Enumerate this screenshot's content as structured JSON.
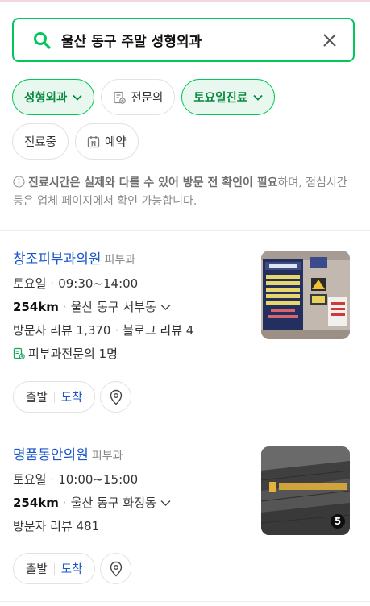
{
  "search": {
    "query": "울산 동구 주말 성형외과"
  },
  "filters": [
    {
      "label": "성형외과",
      "active": true,
      "dropdown": true,
      "icon": ""
    },
    {
      "label": "전문의",
      "active": false,
      "dropdown": false,
      "icon": "certified-doctor-icon"
    },
    {
      "label": "토요일진료",
      "active": true,
      "dropdown": true,
      "icon": ""
    },
    {
      "label": "진료중",
      "active": false,
      "dropdown": false,
      "icon": ""
    },
    {
      "label": "예약",
      "active": false,
      "dropdown": false,
      "icon": "naver-booking-icon"
    }
  ],
  "notice": {
    "bold": "진료시간은 실제와 다를 수 있어 방문 전 확인이 필요",
    "rest": "하며, 점심시간 등은 업체 페이지에서 확인 가능합니다."
  },
  "results": [
    {
      "name": "창조피부과의원",
      "category": "피부과",
      "day": "토요일",
      "hours": "09:30~14:00",
      "distance": "254km",
      "address": "울산 동구 서부동",
      "reviews": "방문자 리뷰 1,370",
      "blog": "블로그 리뷰 4",
      "specialist": "피부과전문의 1명",
      "photo_count": "",
      "depart": "출발",
      "arrive": "도착"
    },
    {
      "name": "명품동안의원",
      "category": "피부과",
      "day": "토요일",
      "hours": "10:00~15:00",
      "distance": "254km",
      "address": "울산 동구 화정동",
      "reviews": "방문자 리뷰 481",
      "blog": "",
      "specialist": "",
      "photo_count": "5",
      "depart": "출발",
      "arrive": "도착"
    }
  ],
  "colors": {
    "brand_green": "#03c75a",
    "link_blue": "#1a56c9",
    "muted": "#8a8a8a"
  }
}
